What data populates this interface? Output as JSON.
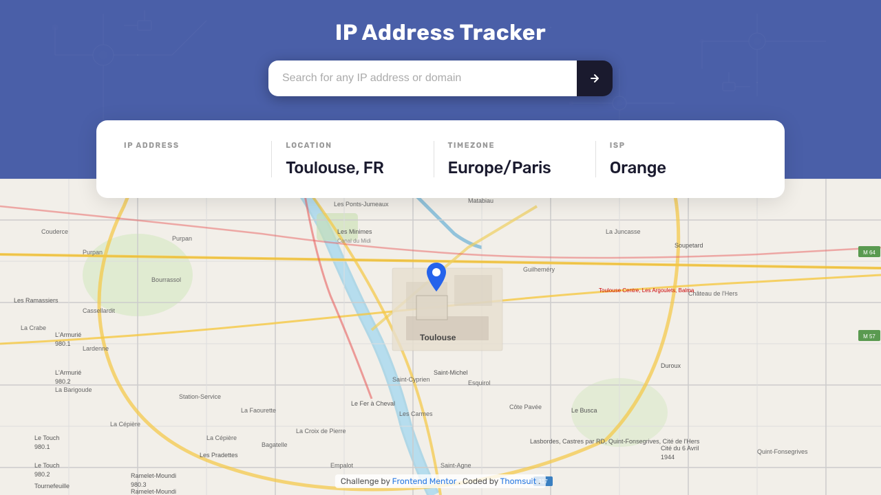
{
  "header": {
    "title": "IP Address Tracker",
    "search": {
      "placeholder": "Search for any IP address or domain",
      "button_label": "›"
    }
  },
  "info_card": {
    "sections": [
      {
        "label": "IP ADDRESS",
        "value": "",
        "id": "ip-address"
      },
      {
        "label": "LOCATION",
        "value": "Toulouse, FR",
        "id": "location"
      },
      {
        "label": "TIMEZONE",
        "value": "Europe/Paris",
        "id": "timezone"
      },
      {
        "label": "ISP",
        "value": "Orange",
        "id": "isp"
      }
    ]
  },
  "footer": {
    "challenge_text": "Challenge by",
    "challenge_link_text": "Frontend Mentor",
    "coded_text": ". Coded by",
    "coder_link_text": "Thomsuit",
    "period": "."
  },
  "map": {
    "center_lat": 43.6047,
    "center_lon": 1.4442,
    "city": "Toulouse"
  },
  "colors": {
    "header_bg": "#4a5fa8",
    "header_bg_dark": "#3a4f98",
    "button_bg": "#1a1a2e",
    "card_bg": "#ffffff",
    "text_dark": "#1a1a2e",
    "text_label": "#999999",
    "divider": "#e0e0e0"
  }
}
